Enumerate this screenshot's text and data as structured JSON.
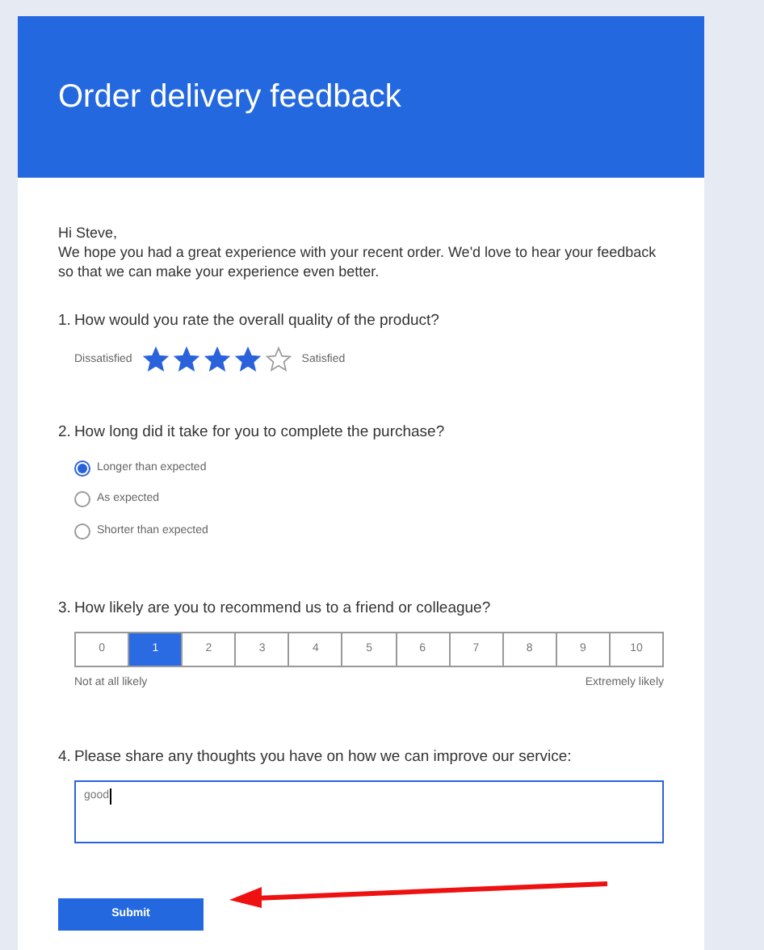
{
  "header": {
    "title": "Order delivery feedback"
  },
  "greeting": "Hi Steve,",
  "intro": "We hope you had a great experience with your recent order. We'd love to hear your feedback so that we can make your experience even better.",
  "questions": [
    {
      "kind": "rating",
      "number": "1.",
      "text": "How would you rate the overall quality of the product?",
      "low_label": "Dissatisfied",
      "high_label": "Satisfied",
      "stars": 4
    },
    {
      "kind": "choice",
      "number": "2.",
      "text": "How long did it take for you to complete the purchase?",
      "options": [
        {
          "label": "Longer than expected",
          "selected": true
        },
        {
          "label": "As expected",
          "selected": false
        },
        {
          "label": "Shorter than expected",
          "selected": false
        }
      ]
    },
    {
      "kind": "scale",
      "number": "3.",
      "text": "How likely are you to recommend us to a friend or colleague?",
      "options": [
        {
          "label": "0",
          "selected": false
        },
        {
          "label": "1",
          "selected": true
        },
        {
          "label": "2",
          "selected": false
        },
        {
          "label": "3",
          "selected": false
        },
        {
          "label": "4",
          "selected": false
        },
        {
          "label": "5",
          "selected": false
        },
        {
          "label": "6",
          "selected": false
        },
        {
          "label": "7",
          "selected": false
        },
        {
          "label": "8",
          "selected": false
        },
        {
          "label": "9",
          "selected": false
        },
        {
          "label": "10",
          "selected": false
        }
      ],
      "low_label": "Not at all likely",
      "high_label": "Extremely likely"
    },
    {
      "kind": "text",
      "number": "4.",
      "text": "Please share any thoughts you have on how we can improve our service:",
      "value": "good"
    }
  ],
  "submit": "Submit"
}
